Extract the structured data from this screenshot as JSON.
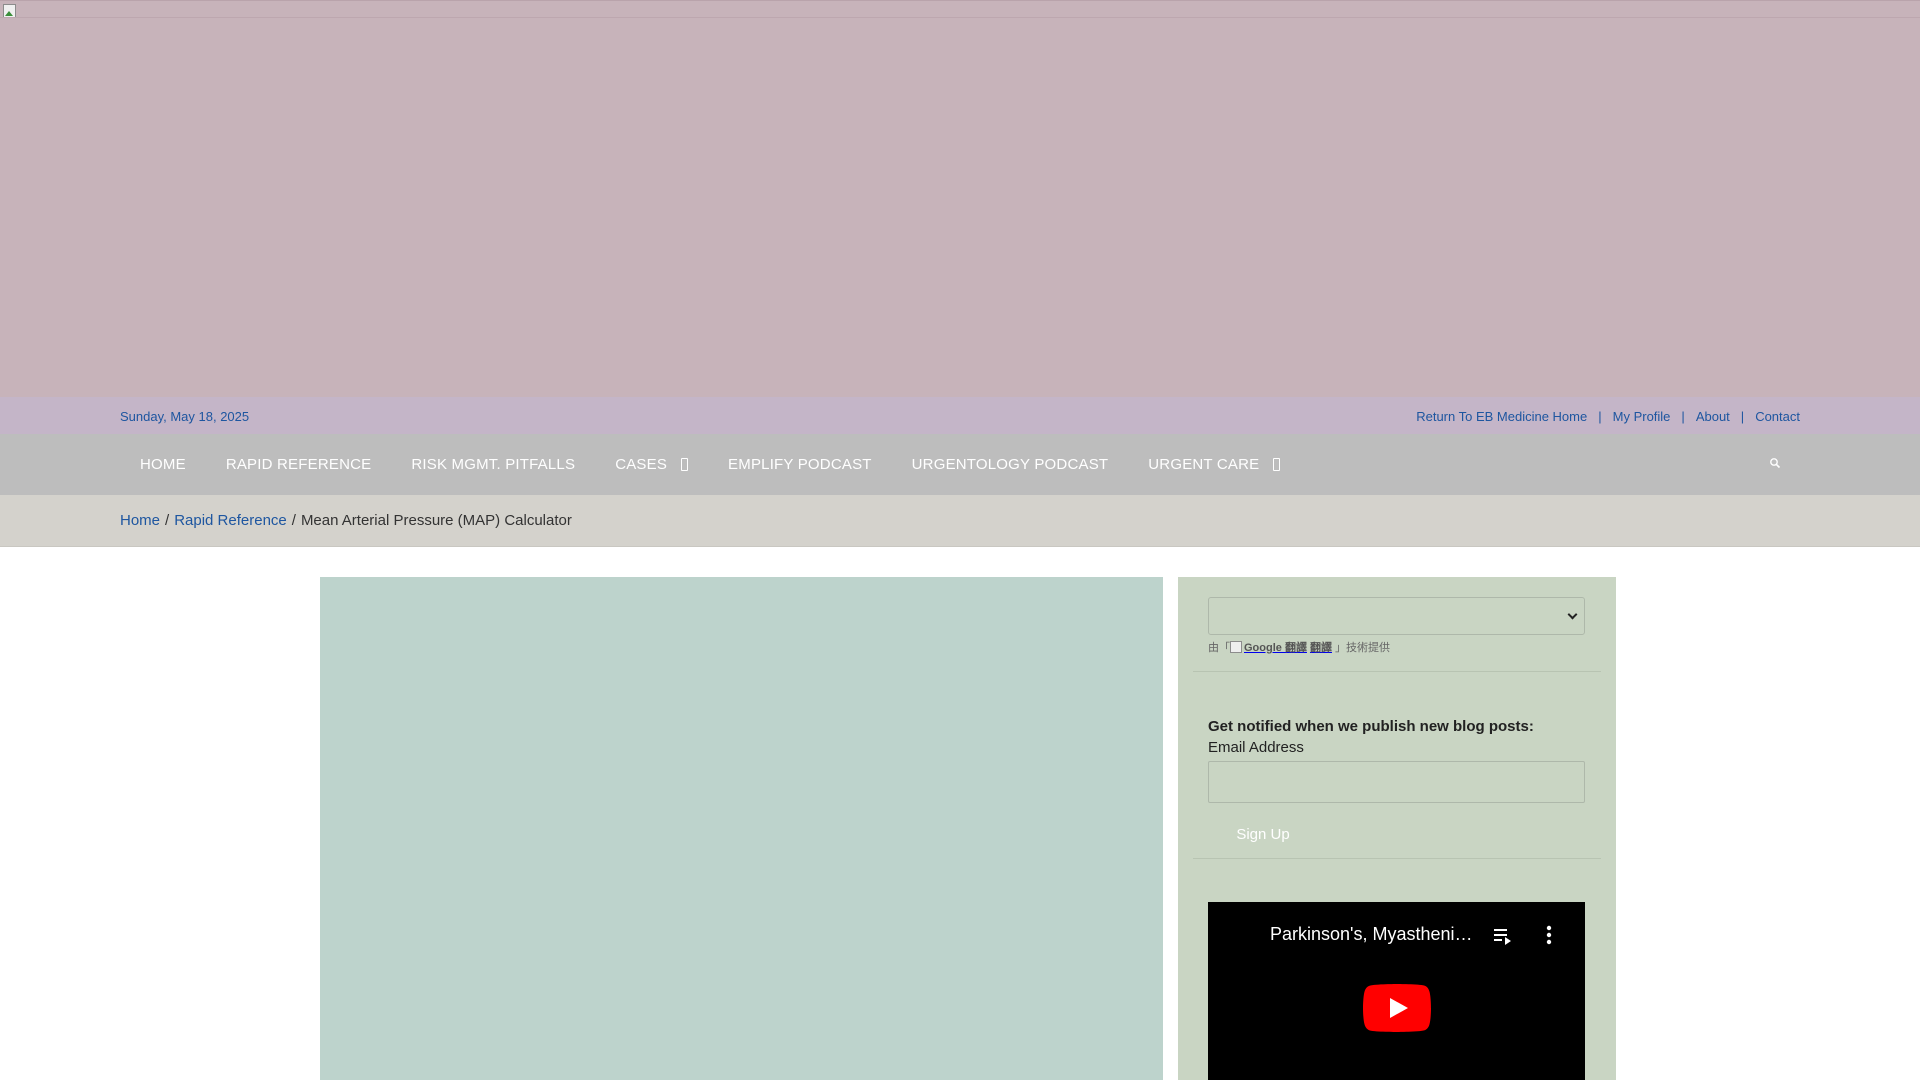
{
  "topbar": {
    "date": "Sunday, May 18, 2025",
    "links": [
      "Return To EB Medicine Home",
      "My Profile",
      "About",
      "Contact"
    ]
  },
  "nav": {
    "items": [
      {
        "label": "HOME"
      },
      {
        "label": "RAPID REFERENCE"
      },
      {
        "label": "RISK MGMT. PITFALLS"
      },
      {
        "label": "CASES"
      },
      {
        "label": "EMPLIFY PODCAST"
      },
      {
        "label": "URGENTOLOGY PODCAST"
      },
      {
        "label": "URGENT CARE"
      }
    ],
    "search_icon": "search-icon"
  },
  "breadcrumb": {
    "home": "Home",
    "section": "Rapid Reference",
    "current": "Mean Arterial Pressure (MAP) Calculator"
  },
  "sidebar": {
    "translate": {
      "powered_prefix": "由「",
      "google_alt": "Google 翻譯",
      "translate_word": "翻譯",
      "powered_suffix": "」技術提供"
    },
    "subscribe": {
      "title": "Get notified when we publish new blog posts:",
      "email_label": "Email Address",
      "button": "Sign Up"
    },
    "video": {
      "title": "Parkinson's, Myasthenia Gravis, and Multiple Sclerosis"
    }
  },
  "colors": {
    "link": "#1e56a0",
    "hero": "#c7b3ba",
    "topbar": "#c4b5c8",
    "navbar": "#bdbdbd",
    "breadcrumb_bar": "#d4d2cc",
    "main_block": "#bdd3cc",
    "sidebar": "#c9d5c3",
    "youtube_red": "#ff0000"
  }
}
